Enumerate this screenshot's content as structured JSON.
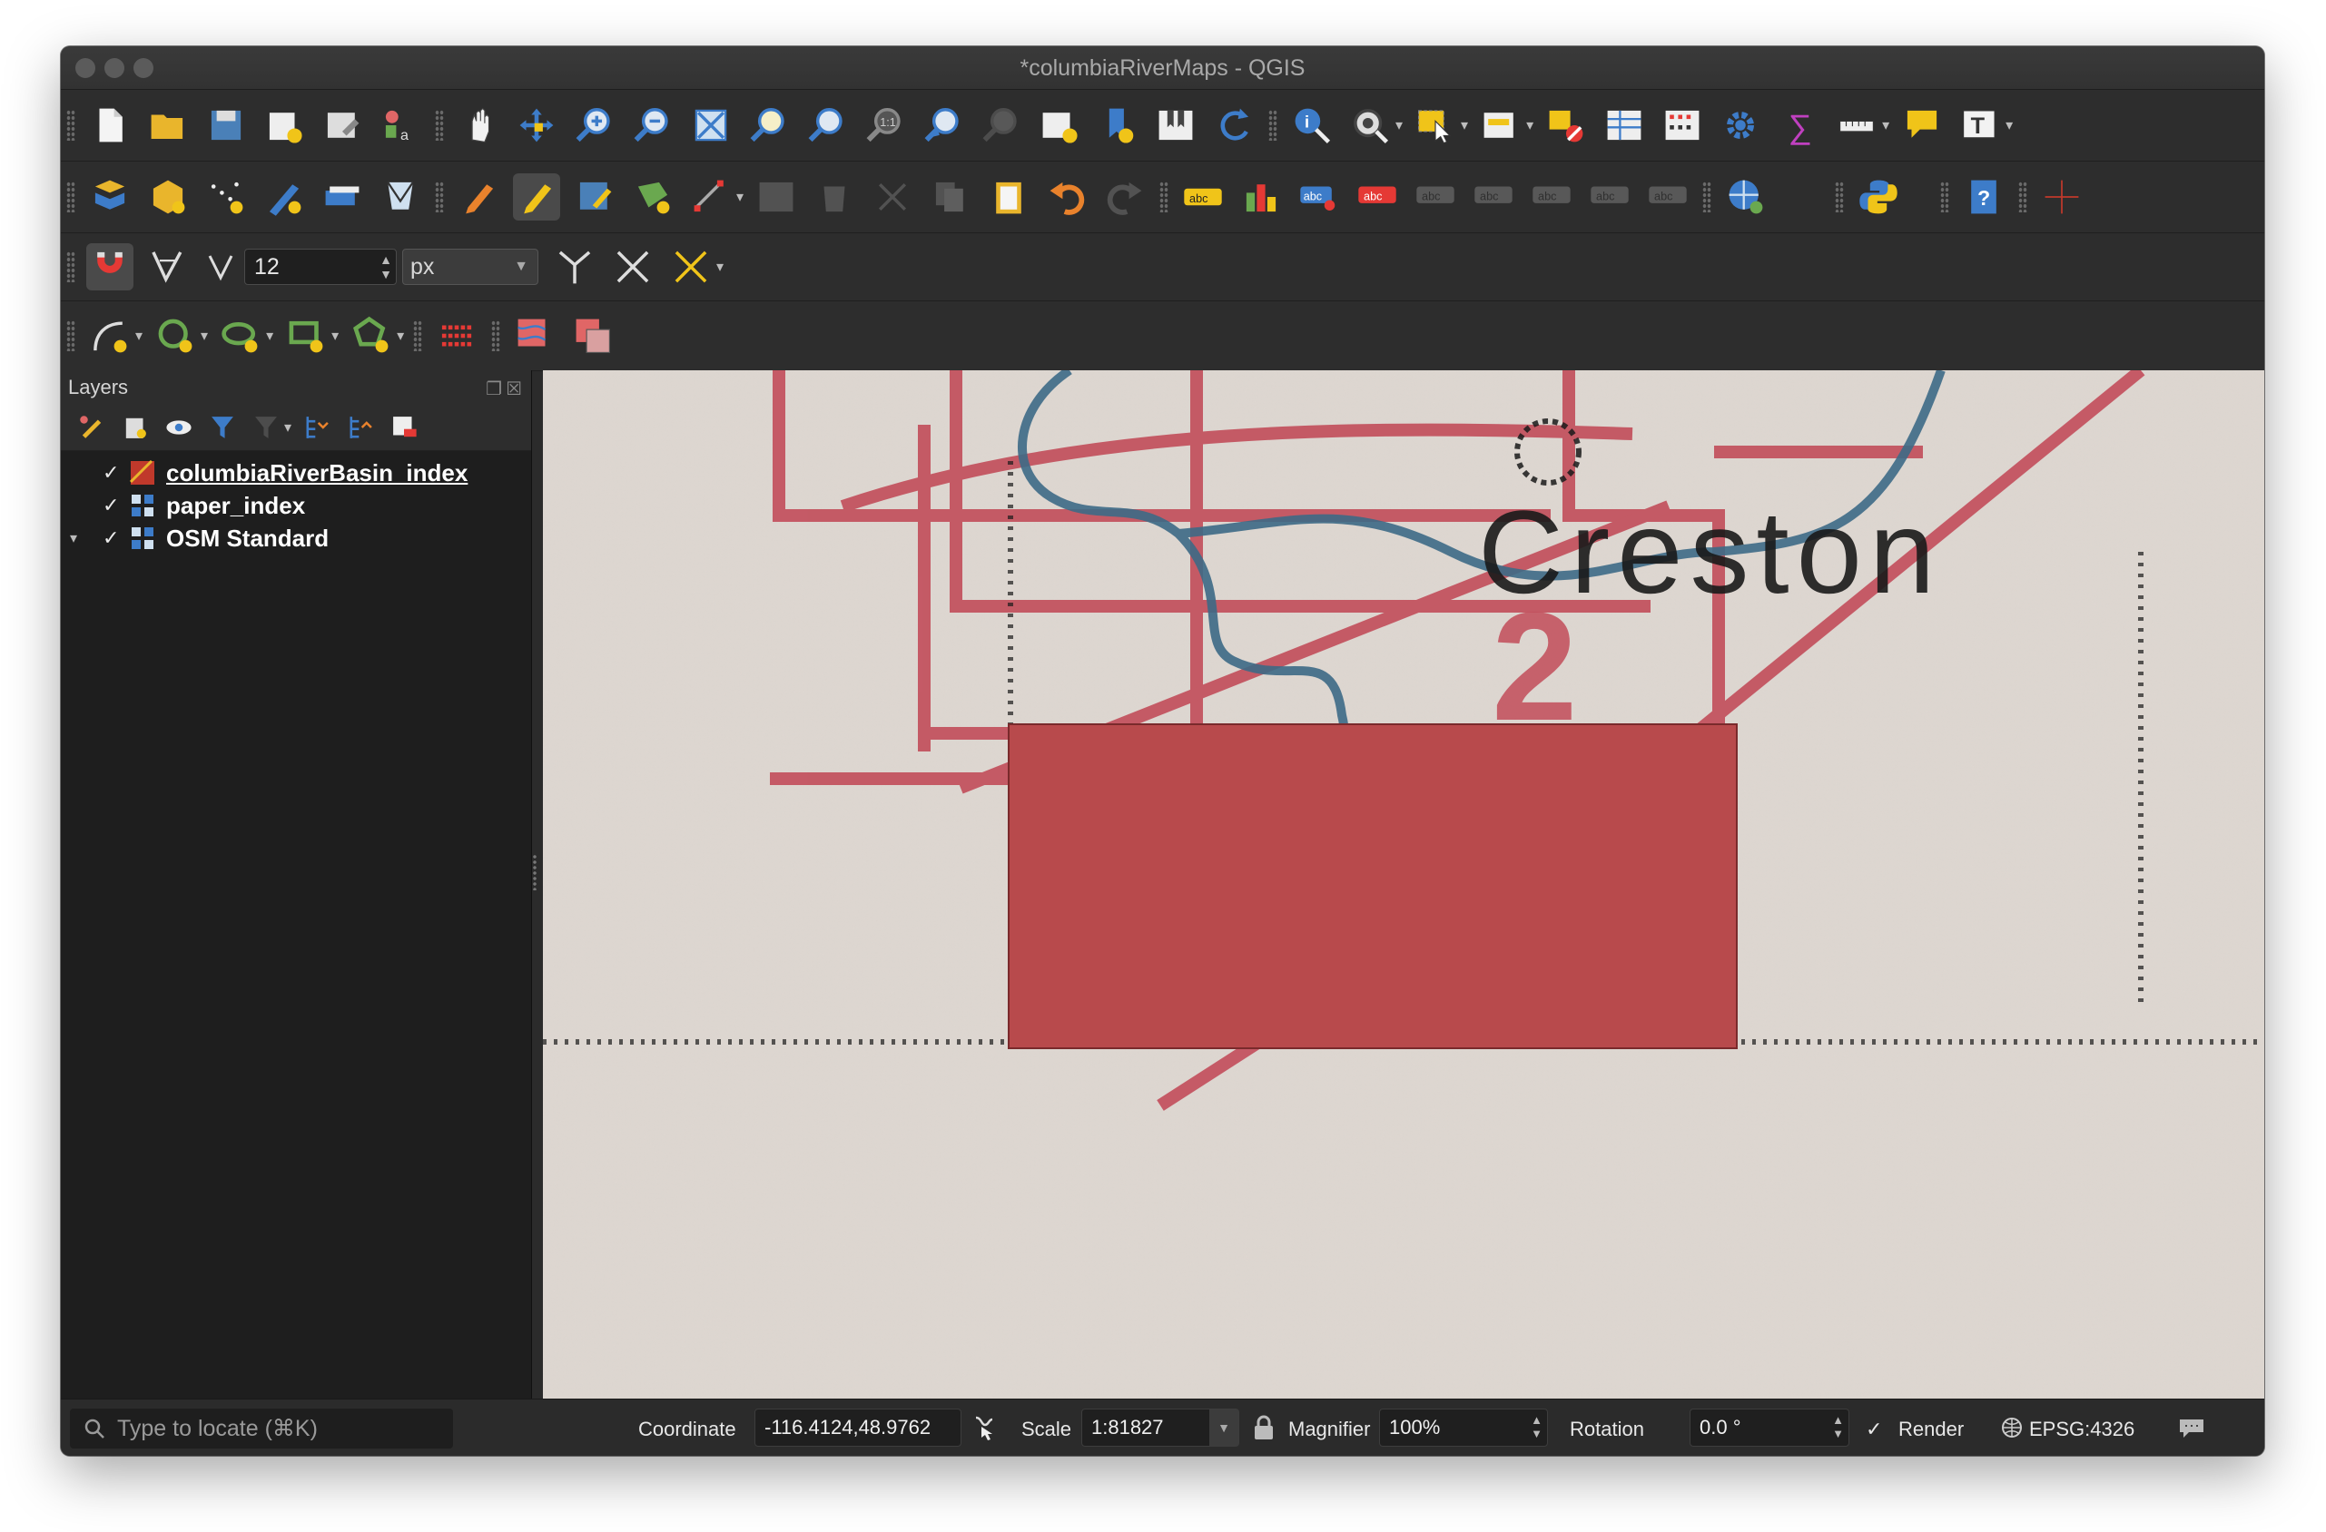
{
  "window": {
    "title": "*columbiaRiverMaps - QGIS"
  },
  "snapping": {
    "tolerance_value": "12",
    "unit": "px"
  },
  "layers_panel": {
    "title": "Layers",
    "layers": [
      {
        "name": "columbiaRiverBasin_index",
        "checked": "✓",
        "active": true
      },
      {
        "name": "paper_index",
        "checked": "✓"
      },
      {
        "name": "OSM Standard",
        "checked": "✓",
        "expander": "▾"
      }
    ]
  },
  "map": {
    "label_text": "Creston",
    "grid_number": "2",
    "colors": {
      "background": "#dcd5cf",
      "red_lines": "#c24d5a",
      "river": "#3d6a86",
      "selection_fill": "#b84a4c"
    }
  },
  "statusbar": {
    "locator_placeholder": "Type to locate (⌘K)",
    "coordinate_label": "Coordinate",
    "coordinate_value": "-116.4124,48.9762",
    "scale_label": "Scale",
    "scale_value": "1:81827",
    "magnifier_label": "Magnifier",
    "magnifier_value": "100%",
    "rotation_label": "Rotation",
    "rotation_value": "0.0 °",
    "render_label": "Render",
    "render_checked": "✓",
    "crs": "EPSG:4326"
  }
}
